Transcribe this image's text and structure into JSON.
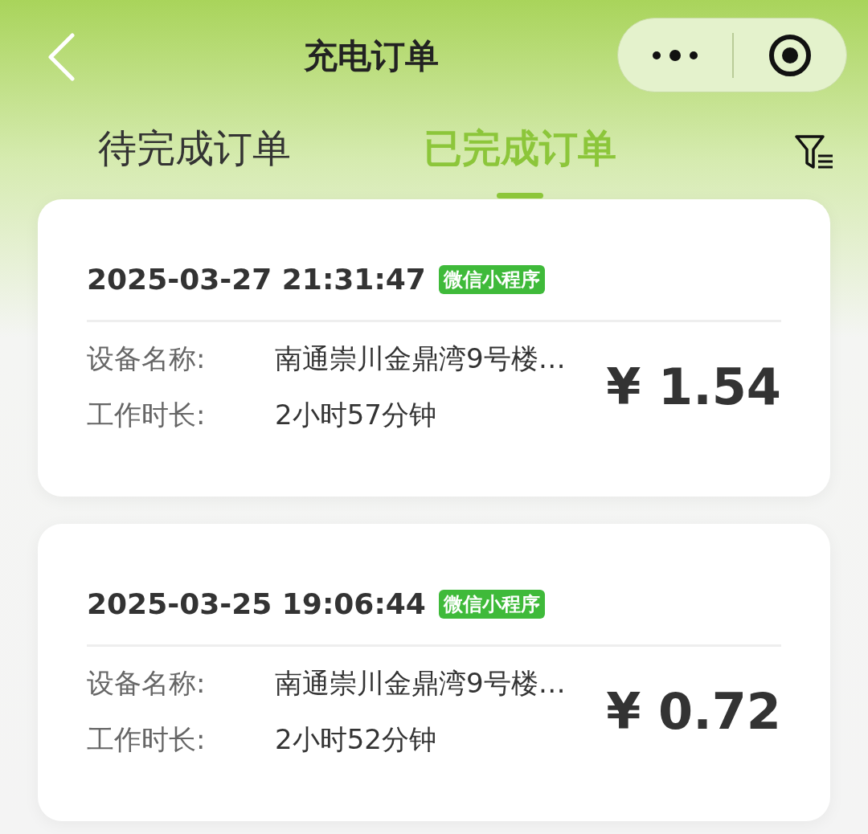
{
  "nav": {
    "title": "充电订单"
  },
  "tabs": [
    {
      "label": "待完成订单",
      "selected": false
    },
    {
      "label": "已完成订单",
      "selected": true
    }
  ],
  "orders": [
    {
      "datetime": "2025-03-27 21:31:47",
      "source": "微信小程序",
      "device_label": "设备名称:",
      "device_name": "南通崇川金鼎湾9号楼…",
      "duration_label": "工作时长:",
      "duration": "2小时57分钟",
      "currency": "¥",
      "amount": "1.54"
    },
    {
      "datetime": "2025-03-25 19:06:44",
      "source": "微信小程序",
      "device_label": "设备名称:",
      "device_name": "南通崇川金鼎湾9号楼…",
      "duration_label": "工作时长:",
      "duration": "2小时52分钟",
      "currency": "¥",
      "amount": "0.72"
    }
  ]
}
